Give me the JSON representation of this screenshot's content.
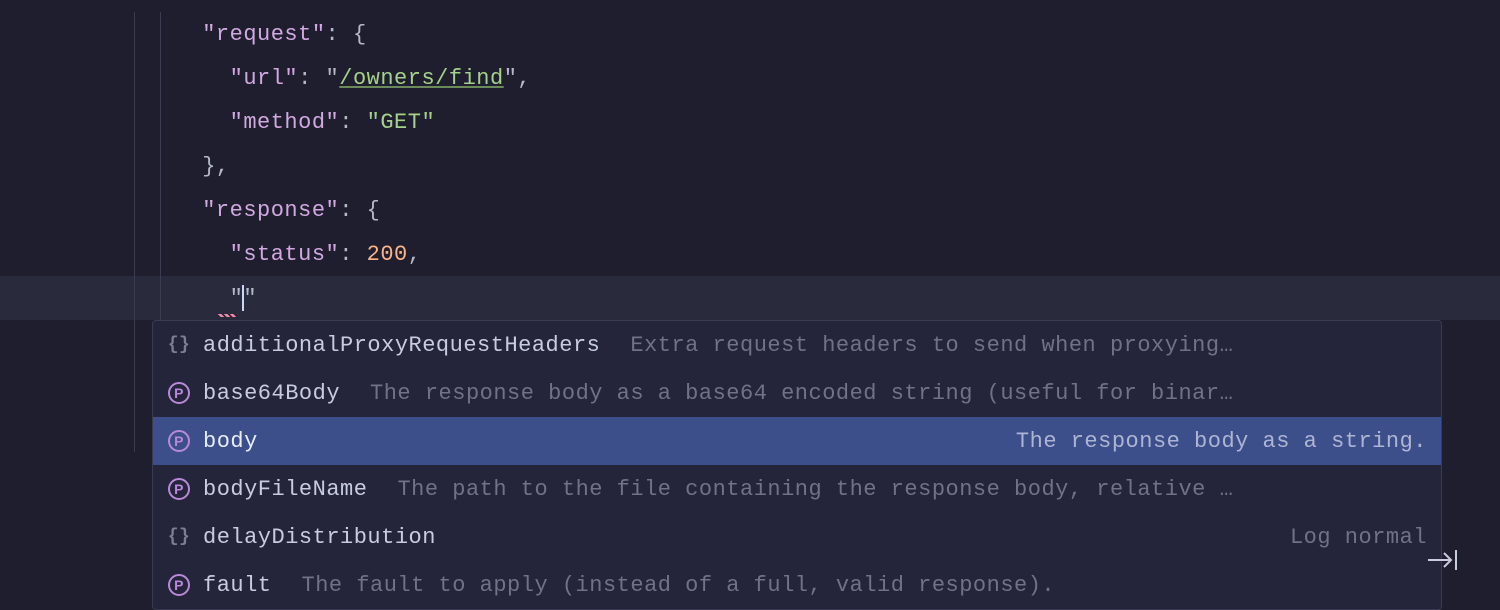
{
  "code": {
    "lines": [
      {
        "indent": 3,
        "tokens": [
          [
            "key",
            "\"request\""
          ],
          [
            "punc",
            ": {"
          ]
        ]
      },
      {
        "indent": 4,
        "tokens": [
          [
            "key",
            "\"url\""
          ],
          [
            "punc",
            ": "
          ],
          [
            "punc",
            "\""
          ],
          [
            "link",
            "/owners/find"
          ],
          [
            "punc",
            "\""
          ],
          [
            "punc",
            ","
          ]
        ]
      },
      {
        "indent": 4,
        "tokens": [
          [
            "key",
            "\"method\""
          ],
          [
            "punc",
            ": "
          ],
          [
            "str",
            "\"GET\""
          ]
        ]
      },
      {
        "indent": 3,
        "tokens": [
          [
            "punc",
            "},"
          ]
        ]
      },
      {
        "indent": 3,
        "tokens": [
          [
            "key",
            "\"response\""
          ],
          [
            "punc",
            ": {"
          ]
        ]
      },
      {
        "indent": 4,
        "tokens": [
          [
            "key",
            "\"status\""
          ],
          [
            "punc",
            ": "
          ],
          [
            "num",
            "200"
          ],
          [
            "punc",
            ","
          ]
        ]
      },
      {
        "indent": 4,
        "active": true,
        "cursor": true,
        "tokens": [
          [
            "punc",
            "\""
          ],
          [
            "cursor",
            ""
          ],
          [
            "punc",
            "\""
          ]
        ]
      },
      {
        "indent": 4,
        "tokens": []
      },
      {
        "indent": 2,
        "tokens": [
          [
            "punc",
            "}"
          ]
        ]
      },
      {
        "indent": 2,
        "tokens": [
          [
            "punc",
            "{"
          ]
        ]
      }
    ]
  },
  "popup": {
    "items": [
      {
        "icon": "braces",
        "label": "additionalProxyRequestHeaders",
        "desc": "Extra request headers to send when proxying…",
        "selected": false,
        "descAlign": "left"
      },
      {
        "icon": "p",
        "label": "base64Body",
        "desc": "The response body as a base64 encoded string (useful for binar…",
        "selected": false,
        "descAlign": "left"
      },
      {
        "icon": "p",
        "label": "body",
        "desc": "The response body as a string.",
        "selected": true,
        "descAlign": "right"
      },
      {
        "icon": "p",
        "label": "bodyFileName",
        "desc": "The path to the file containing the response body, relative …",
        "selected": false,
        "descAlign": "left"
      },
      {
        "icon": "braces",
        "label": "delayDistribution",
        "desc": "Log normal",
        "selected": false,
        "descAlign": "right"
      },
      {
        "icon": "p",
        "label": "fault",
        "desc": "The fault to apply (instead of a full, valid response).",
        "selected": false,
        "descAlign": "left"
      }
    ]
  }
}
